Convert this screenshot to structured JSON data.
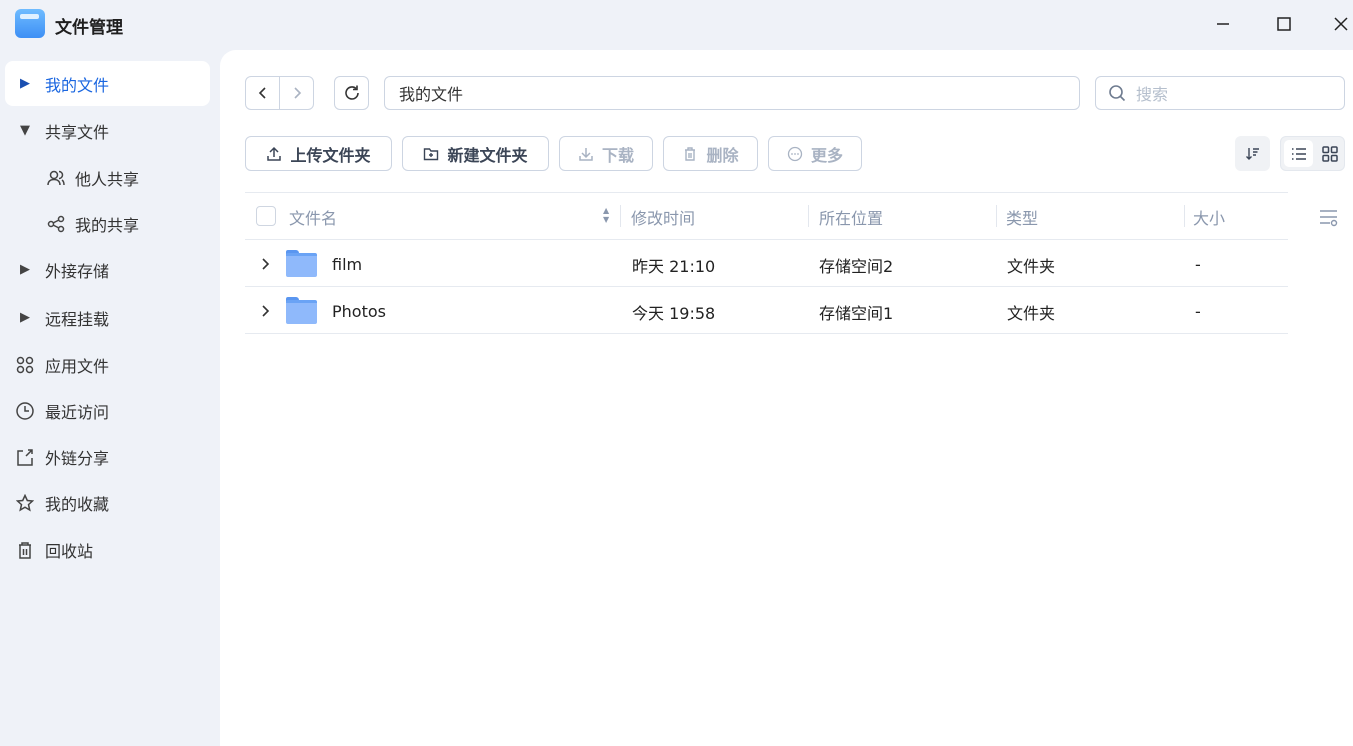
{
  "app": {
    "title": "文件管理"
  },
  "window": {
    "minimize": "—",
    "maximize": "☐",
    "close": "✕"
  },
  "sidebar": {
    "items": [
      {
        "label": "我的文件",
        "icon": "caret-right-icon",
        "active": true
      },
      {
        "label": "共享文件",
        "icon": "caret-down-icon"
      },
      {
        "label": "他人共享",
        "icon": "users-icon"
      },
      {
        "label": "我的共享",
        "icon": "share-icon"
      },
      {
        "label": "外接存储",
        "icon": "caret-right-icon"
      },
      {
        "label": "远程挂载",
        "icon": "caret-right-icon"
      },
      {
        "label": "应用文件",
        "icon": "apps-icon"
      },
      {
        "label": "最近访问",
        "icon": "clock-icon"
      },
      {
        "label": "外链分享",
        "icon": "external-share-icon"
      },
      {
        "label": "我的收藏",
        "icon": "star-icon"
      },
      {
        "label": "回收站",
        "icon": "trash-icon"
      }
    ]
  },
  "toolbar": {
    "path": "我的文件",
    "search_placeholder": "搜索",
    "upload_folder": "上传文件夹",
    "new_folder": "新建文件夹",
    "download": "下载",
    "delete": "删除",
    "more": "更多"
  },
  "table": {
    "headers": {
      "name": "文件名",
      "modified": "修改时间",
      "location": "所在位置",
      "type": "类型",
      "size": "大小"
    },
    "rows": [
      {
        "name": "film",
        "modified": "昨天 21:10",
        "location": "存储空间2",
        "type": "文件夹",
        "size": "-"
      },
      {
        "name": "Photos",
        "modified": "今天 19:58",
        "location": "存储空间1",
        "type": "文件夹",
        "size": "-"
      }
    ]
  },
  "colors": {
    "accent": "#1a66e0",
    "sidebar_bg": "#eff2f8"
  }
}
